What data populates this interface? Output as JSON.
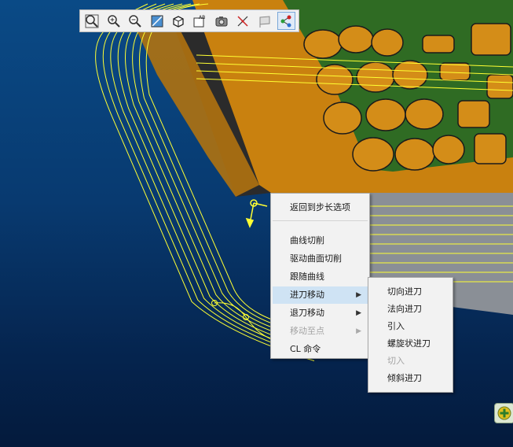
{
  "colors": {
    "part_orange": "#c9810f",
    "part_orange_dark": "#8e5a06",
    "pcb_green": "#2f6b23",
    "pad_orange": "#d48d18",
    "toolpath_yellow": "#ffff33",
    "wall_dark": "#2b2b2b",
    "flat_gray": "#8a8f96",
    "menu_bg": "#f2f2f2",
    "menu_highlight": "#cfe3f4"
  },
  "toolbar": {
    "buttons": [
      {
        "name": "zoom-fit-button",
        "icon": "magnifier-icon",
        "active": false
      },
      {
        "name": "zoom-in-button",
        "icon": "zoom-in-icon",
        "active": false
      },
      {
        "name": "zoom-out-button",
        "icon": "zoom-out-icon",
        "active": false
      },
      {
        "name": "shaded-view-button",
        "icon": "shaded-face-icon",
        "active": false
      },
      {
        "name": "view-orientation-button",
        "icon": "cube-icon",
        "active": false
      },
      {
        "name": "annotation-button",
        "icon": "ab-annotation-icon",
        "active": false
      },
      {
        "name": "snapshot-button",
        "icon": "camera-icon",
        "active": false
      },
      {
        "name": "toolpath-display-button",
        "icon": "xyz-axes-icon",
        "active": false
      },
      {
        "name": "section-button",
        "icon": "flag-icon",
        "active": false
      },
      {
        "name": "node-graph-button",
        "icon": "node-graph-icon",
        "active": true
      }
    ]
  },
  "context_menu": {
    "items": [
      {
        "label": "返回到步长选项",
        "enabled": true,
        "submenu": false
      },
      {
        "separator": true
      },
      {
        "label": "曲线切削",
        "enabled": true,
        "submenu": false
      },
      {
        "label": "驱动曲面切削",
        "enabled": true,
        "submenu": false
      },
      {
        "label": "跟随曲线",
        "enabled": true,
        "submenu": false
      },
      {
        "label": "进刀移动",
        "enabled": true,
        "submenu": true,
        "highlighted": true
      },
      {
        "label": "退刀移动",
        "enabled": true,
        "submenu": true
      },
      {
        "label": "移动至点",
        "enabled": false,
        "submenu": true
      },
      {
        "label": "CL 命令",
        "enabled": true,
        "submenu": false
      }
    ]
  },
  "submenu": {
    "items": [
      {
        "label": "切向进刀",
        "enabled": true
      },
      {
        "label": "法向进刀",
        "enabled": true
      },
      {
        "label": "引入",
        "enabled": true
      },
      {
        "label": "螺旋状进刀",
        "enabled": true
      },
      {
        "label": "切入",
        "enabled": false
      },
      {
        "label": "倾斜进刀",
        "enabled": true
      }
    ]
  },
  "submenu_arrow": "▶"
}
